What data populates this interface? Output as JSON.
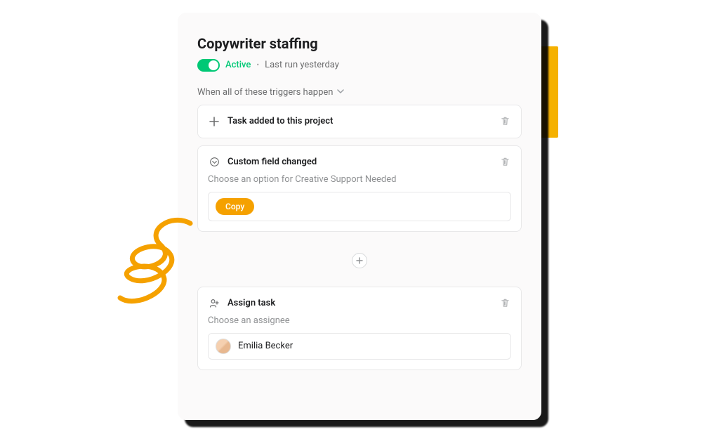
{
  "panel": {
    "title": "Copywriter staffing",
    "status": {
      "active_label": "Active",
      "last_run": "Last run yesterday"
    },
    "triggers_header": "When all of these triggers happen"
  },
  "trigger1": {
    "title": "Task added to this project"
  },
  "trigger2": {
    "title": "Custom field changed",
    "description": "Choose an option for Creative Support Needed",
    "option_label": "Copy"
  },
  "action": {
    "title": "Assign task",
    "description": "Choose an assignee",
    "assignee_name": "Emilia Becker"
  }
}
